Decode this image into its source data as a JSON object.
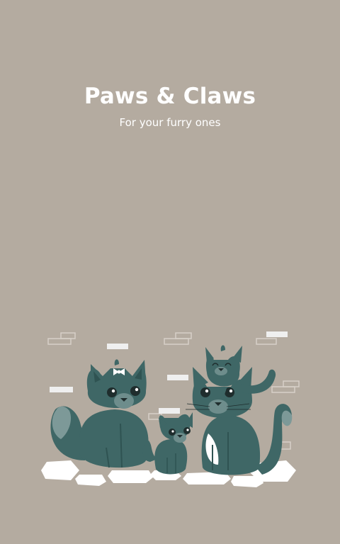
{
  "app": {
    "title": "Paws & Claws",
    "tagline": "For your furry ones"
  },
  "colors": {
    "background": "#b4aba0",
    "text": "#ffffff",
    "cat_body": "#3f6766",
    "cat_muzzle": "#6e8d8c",
    "brick": "#ececec",
    "paving": "#ffffff"
  },
  "illustration": {
    "subject": "family of four cats sitting in front of a brick wall"
  }
}
